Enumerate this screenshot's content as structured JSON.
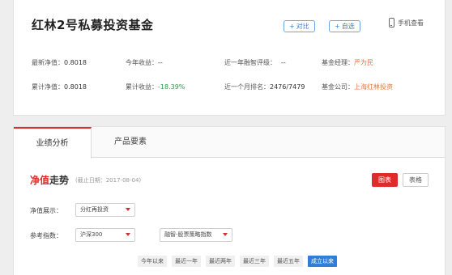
{
  "fund": {
    "title": "红林2号私募投资基金",
    "compare_label": "对比",
    "watch_label": "自选",
    "mobile_label": "手机查看"
  },
  "info": {
    "nav_label": "最新净值：",
    "nav_value": "0.8018",
    "ytd_label": "今年收益：",
    "ytd_value": "--",
    "rating_label": "近一年融智评级：",
    "rating_value": "--",
    "manager_label": "基金经理：",
    "manager_value": "严为民",
    "cum_nav_label": "累计净值：",
    "cum_nav_value": "0.8018",
    "cum_return_label": "累计收益：",
    "cum_return_value": "-18.39%",
    "rank_label": "近一个月排名：",
    "rank_value": "2476/7479",
    "company_label": "基金公司：",
    "company_value": "上海红林投资"
  },
  "tabs": {
    "performance": "业绩分析",
    "elements": "产品要素"
  },
  "trend": {
    "title_red": "净值",
    "title_rest": "走势",
    "deadline": "(截止日期：2017-08-04)",
    "chart_btn": "图表",
    "table_btn": "表格"
  },
  "form": {
    "display_label": "净值展示：",
    "display_value": "分红再投资",
    "index_label": "参考指数：",
    "index_value": "沪深300",
    "strategy_value": "融智-股票策略指数"
  },
  "ranges": [
    "今年以来",
    "最近一年",
    "最近两年",
    "最近三年",
    "最近五年",
    "成立以来"
  ],
  "active_range": "成立以来",
  "colors": {
    "accent_red": "#e02b2b",
    "accent_blue": "#2f7fd8",
    "negative_green": "#2e9e4a",
    "link_orange": "#e8743b"
  }
}
